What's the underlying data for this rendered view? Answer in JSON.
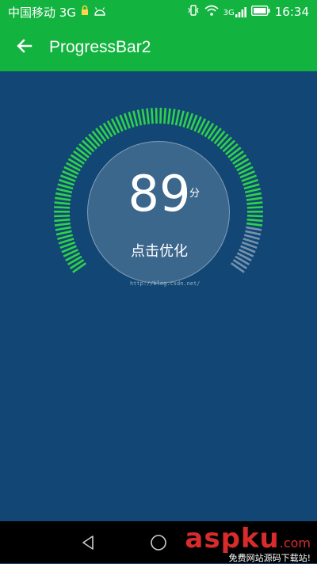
{
  "status_bar": {
    "carrier": "中国移动 3G",
    "network_badge": "3G",
    "time": "16:34",
    "icons": [
      "lock-icon",
      "android-icon",
      "vibrate-icon",
      "wifi-icon",
      "signal-icon",
      "battery-icon"
    ]
  },
  "app_bar": {
    "title": "ProgressBar2",
    "back_icon": "arrow-back-icon"
  },
  "gauge": {
    "progress": 89,
    "max": 100,
    "active_color": "#2ed34a",
    "inactive_color": "#9fb2c6"
  },
  "score": {
    "value": "89",
    "unit": "分",
    "action_label": "点击优化"
  },
  "watermark": "http://blog.csdn.net/",
  "nav_bar": {
    "icons": [
      "back-nav-icon",
      "home-nav-icon"
    ]
  },
  "branding": {
    "logo_text": "aspku",
    "logo_suffix": ".com",
    "subtitle": "免费网站源码下载站!"
  },
  "colors": {
    "app_bar": "#13b340",
    "background": "#124674",
    "brand_red": "#d82b2b"
  }
}
